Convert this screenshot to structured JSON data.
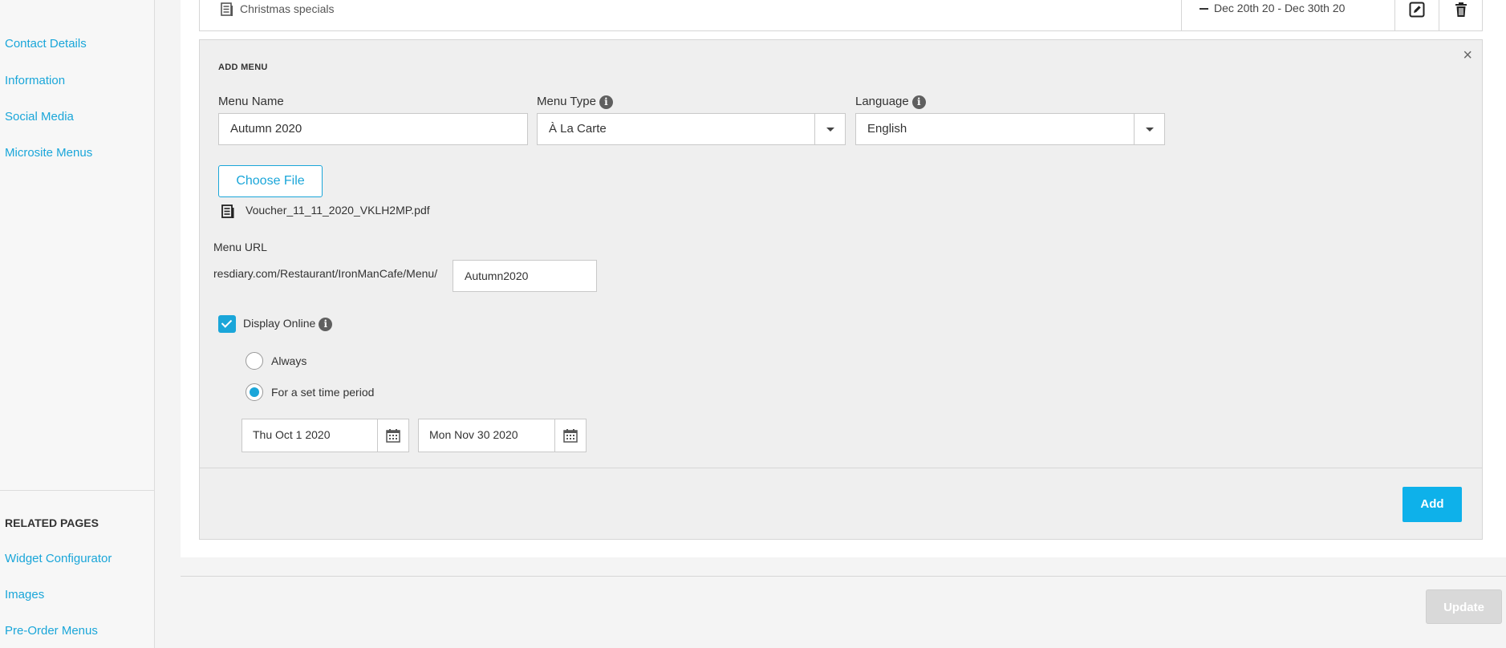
{
  "sidebar": {
    "links": [
      "Contact Details",
      "Information",
      "Social Media",
      "Microsite Menus"
    ],
    "related_heading": "RELATED PAGES",
    "related_links": [
      "Widget Configurator",
      "Images",
      "Pre-Order Menus"
    ]
  },
  "existing_menu": {
    "name": "Christmas specials",
    "dates": "Dec 20th 20 - Dec 30th 20",
    "icons": [
      "edit-icon",
      "trash-icon",
      "document-icon"
    ]
  },
  "add_menu": {
    "title": "ADD MENU",
    "close_label": "×",
    "menu_name_label": "Menu Name",
    "menu_name_value": "Autumn 2020",
    "menu_type_label": "Menu Type",
    "menu_type_value": "À La Carte",
    "language_label": "Language",
    "language_value": "English",
    "info_glyph": "i",
    "choose_file_label": "Choose File",
    "file_name": "Voucher_11_11_2020_VKLH2MP.pdf",
    "menu_url_label": "Menu URL",
    "menu_url_prefix": "resdiary.com/Restaurant/IronManCafe/Menu/",
    "menu_url_slug": "Autumn2020",
    "display_online_label": "Display Online",
    "display_online_checked": true,
    "radio_always_label": "Always",
    "radio_period_label": "For a set time period",
    "selected_radio": "For a set time period",
    "start_date": "Thu Oct 1 2020",
    "end_date": "Mon Nov 30 2020",
    "add_button_label": "Add"
  },
  "update_button_label": "Update",
  "colors": {
    "accent": "#1aa6d9",
    "add_button": "#0eb1ea",
    "disabled_button": "#d9d9d9"
  }
}
